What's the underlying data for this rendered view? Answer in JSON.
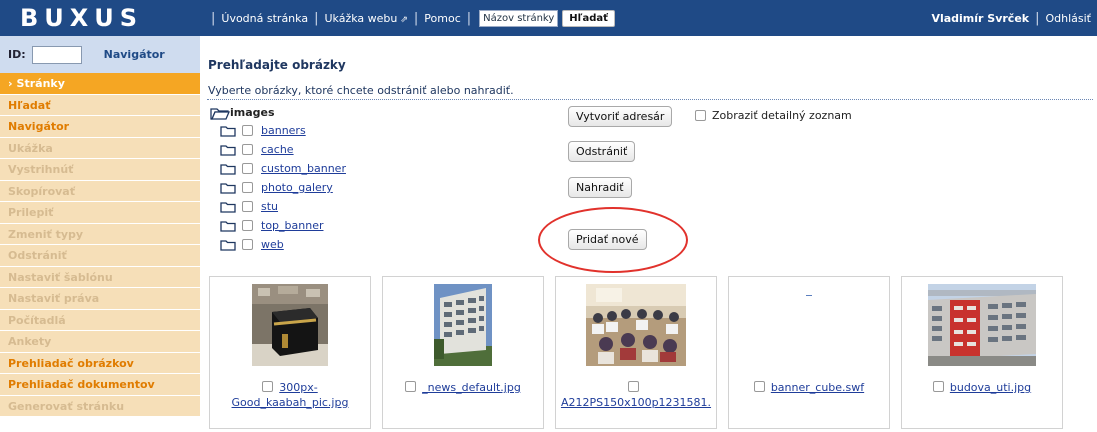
{
  "app": {
    "logo": "BUXUS"
  },
  "topnav": {
    "home": "Úvodná stránka",
    "preview": "Ukážka webu",
    "help": "Pomoc",
    "search_placeholder": "Názov stránky",
    "search_button": "Hľadať"
  },
  "user": {
    "name": "Vladimír Svrček",
    "logout": "Odhlásiť"
  },
  "sidebar": {
    "id_label": "ID:",
    "navigator_link": "Navigátor",
    "items": [
      {
        "label": "Stránky",
        "state": "active"
      },
      {
        "label": "Hľadať",
        "state": "enabled"
      },
      {
        "label": "Navigátor",
        "state": "enabled"
      },
      {
        "label": "Ukážka",
        "state": "disabled"
      },
      {
        "label": "Vystrihnúť",
        "state": "disabled"
      },
      {
        "label": "Skopírovať",
        "state": "disabled"
      },
      {
        "label": "Prilepiť",
        "state": "disabled"
      },
      {
        "label": "Zmeniť typy",
        "state": "disabled"
      },
      {
        "label": "Odstrániť",
        "state": "disabled"
      },
      {
        "label": "Nastaviť šablónu",
        "state": "disabled"
      },
      {
        "label": "Nastaviť práva",
        "state": "disabled"
      },
      {
        "label": "Počítadlá",
        "state": "disabled"
      },
      {
        "label": "Ankety",
        "state": "disabled"
      },
      {
        "label": "Prehliadač obrázkov",
        "state": "enabled"
      },
      {
        "label": "Prehliadač dokumentov",
        "state": "enabled"
      },
      {
        "label": "Generovať stránku",
        "state": "disabled"
      }
    ]
  },
  "main": {
    "title": "Prehľadajte obrázky",
    "subtitle": "Vyberte obrázky, ktoré chcete odstrániť alebo nahradiť.",
    "tree": {
      "root": "images",
      "folders": [
        "banners",
        "cache",
        "custom_banner",
        "photo_galery",
        "stu",
        "top_banner",
        "web"
      ]
    },
    "buttons": {
      "create_dir": "Vytvoriť adresár",
      "delete": "Odstrániť",
      "replace": "Nahradiť",
      "add_new": "Pridať nové"
    },
    "detail_list_label": "Zobraziť detailný zoznam",
    "images": [
      {
        "caption_line1": "300px-",
        "caption_line2": "Good_kaabah_pic.jpg"
      },
      {
        "caption_line1": "_news_default.jpg",
        "caption_line2": ""
      },
      {
        "caption_line1": "",
        "caption_line2": "A212PS150x100p1231581."
      },
      {
        "caption_line1": "banner_cube.swf",
        "caption_line2": ""
      },
      {
        "caption_line1": "budova_uti.jpg",
        "caption_line2": ""
      }
    ]
  },
  "colors": {
    "header_bg": "#1f4a86",
    "menu_active": "#f5a623",
    "menu_bg": "#f6dfb8",
    "menu_text": "#e07c00",
    "highlight": "#e1322c"
  }
}
